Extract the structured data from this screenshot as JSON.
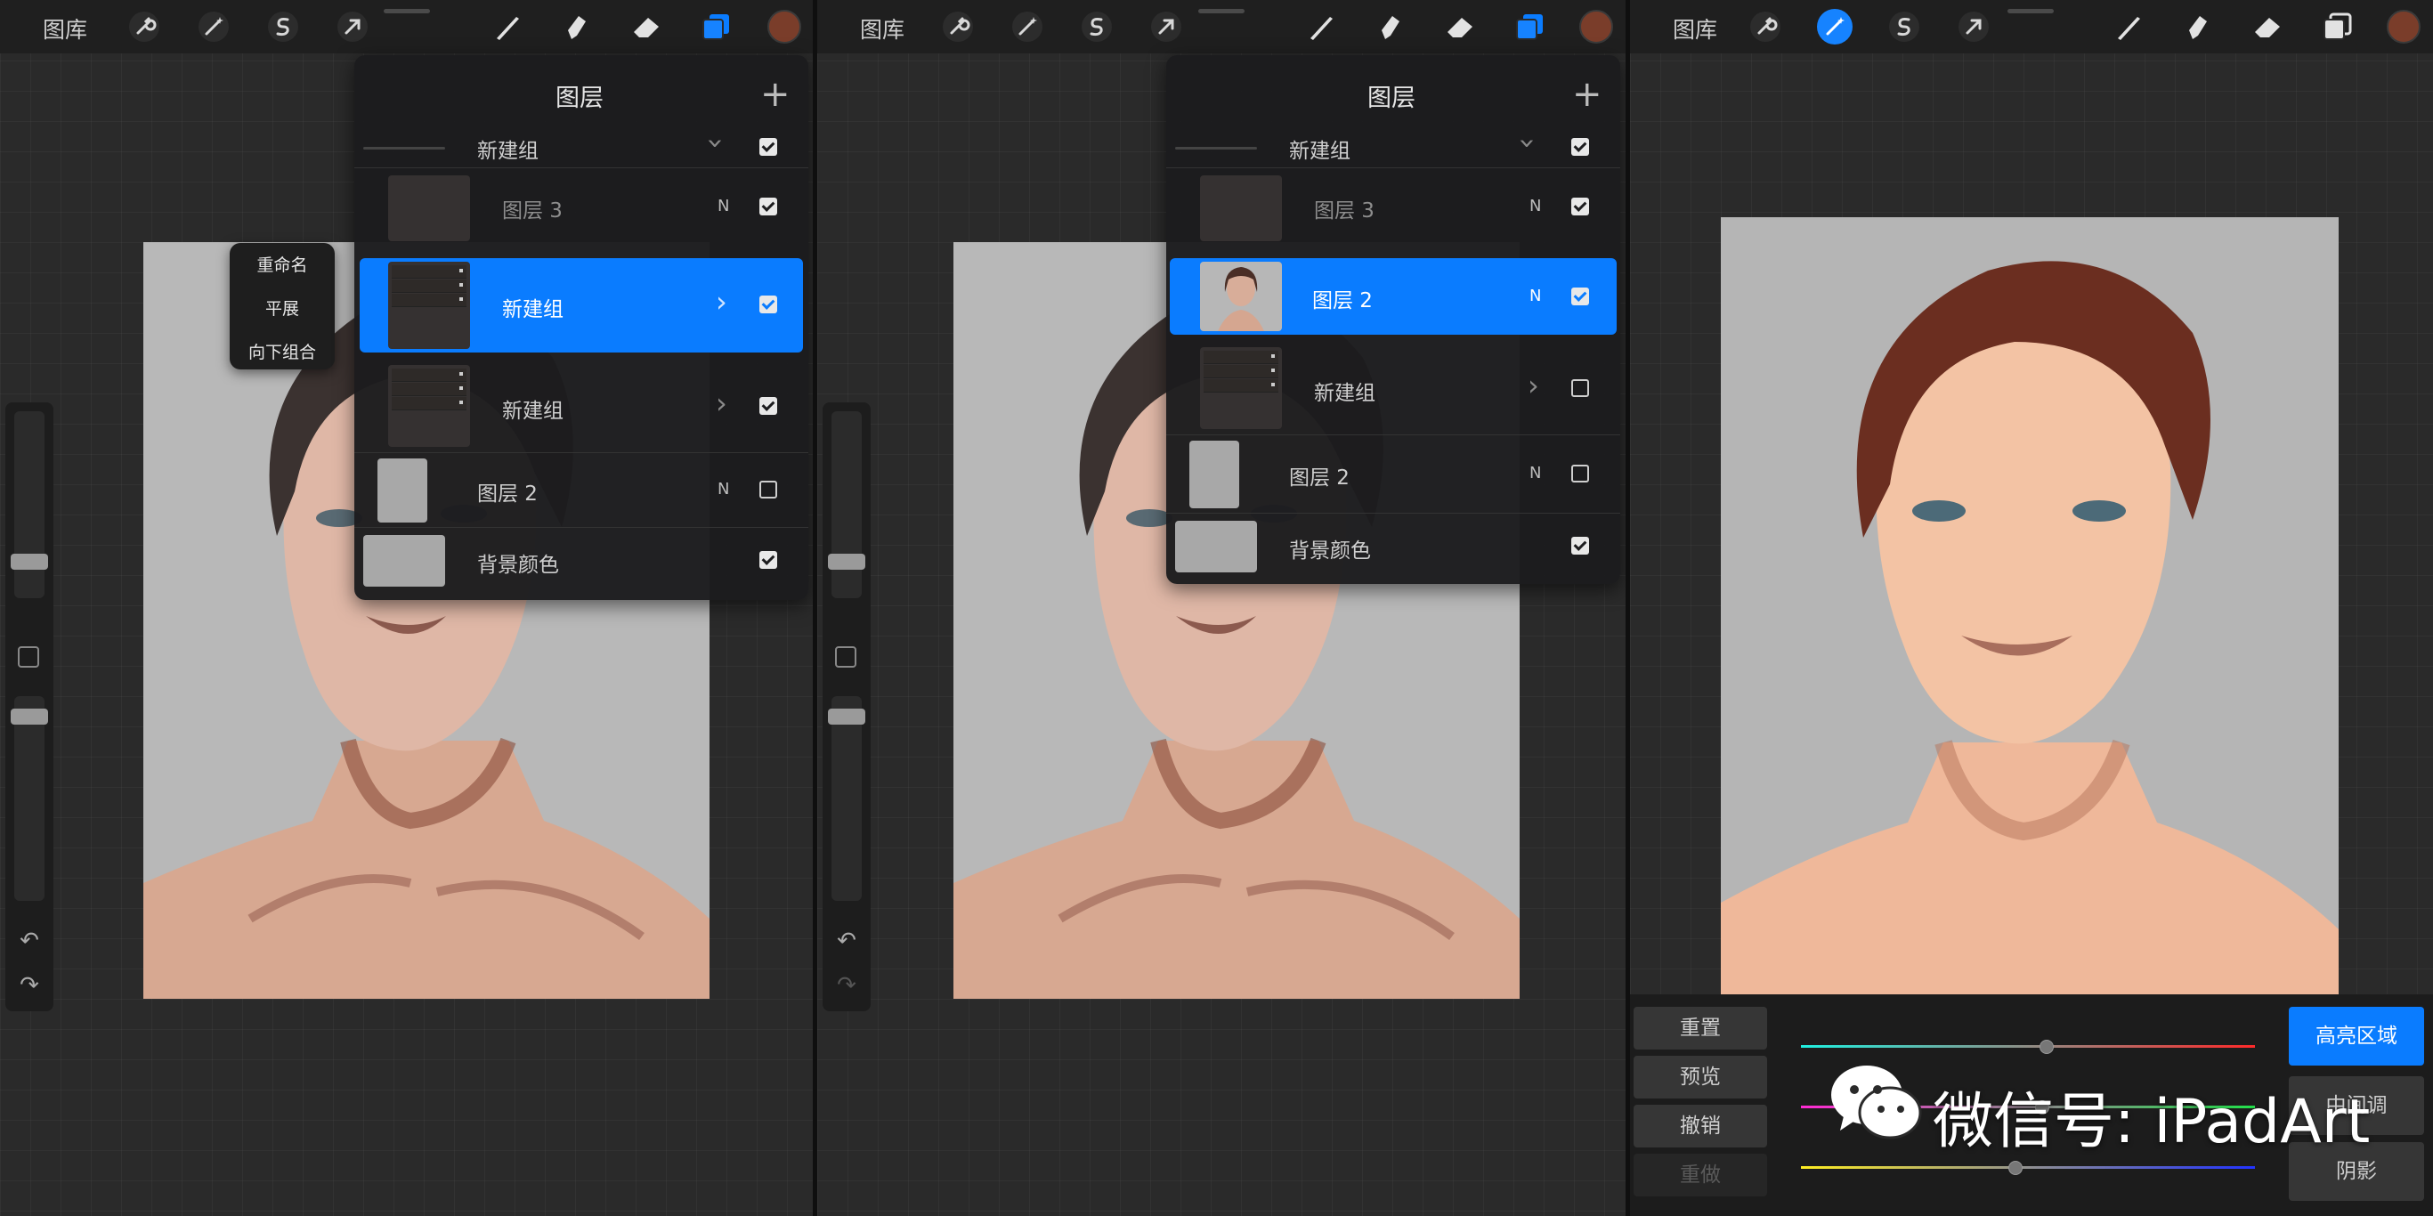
{
  "toolbar": {
    "gallery_label": "图库",
    "icons": [
      "wrench-icon",
      "magic-wand-icon",
      "selection-s-icon",
      "transform-arrow-icon",
      "brush-icon",
      "smudge-icon",
      "eraser-icon",
      "layers-icon"
    ],
    "current_color": "#7a3d2a",
    "accent": "#0a7cff"
  },
  "panel1": {
    "context_menu": [
      "重命名",
      "平展",
      "向下组合"
    ],
    "layers": {
      "title": "图层",
      "rows": [
        {
          "name": "新建组",
          "type": "group-header",
          "visible": true
        },
        {
          "name": "图层 3",
          "mode": "N",
          "visible": true
        },
        {
          "name": "新建组",
          "type": "group",
          "selected": true,
          "visible": true
        },
        {
          "name": "新建组",
          "type": "group",
          "visible": true
        },
        {
          "name": "图层 2",
          "mode": "N",
          "visible": false
        },
        {
          "name": "背景颜色",
          "visible": true
        }
      ]
    }
  },
  "panel2": {
    "layers": {
      "title": "图层",
      "rows": [
        {
          "name": "新建组",
          "type": "group-header",
          "visible": true
        },
        {
          "name": "图层 3",
          "mode": "N",
          "visible": true
        },
        {
          "name": "图层 2",
          "mode": "N",
          "selected": true,
          "visible": true
        },
        {
          "name": "新建组",
          "type": "group",
          "visible": false
        },
        {
          "name": "图层 2",
          "mode": "N",
          "visible": false
        },
        {
          "name": "背景颜色",
          "visible": true
        }
      ]
    }
  },
  "panel3": {
    "adjust": {
      "left_buttons": [
        "重置",
        "预览",
        "撤销",
        "重做"
      ],
      "right_buttons": [
        "高亮区域",
        "中间调",
        "阴影"
      ],
      "active_range": "高亮区域",
      "balance": {
        "cyan_red": 0.54,
        "magenta_green": 0.53,
        "yellow_blue": 0.47
      }
    }
  },
  "watermark": {
    "text": "微信号: iPadArt"
  }
}
